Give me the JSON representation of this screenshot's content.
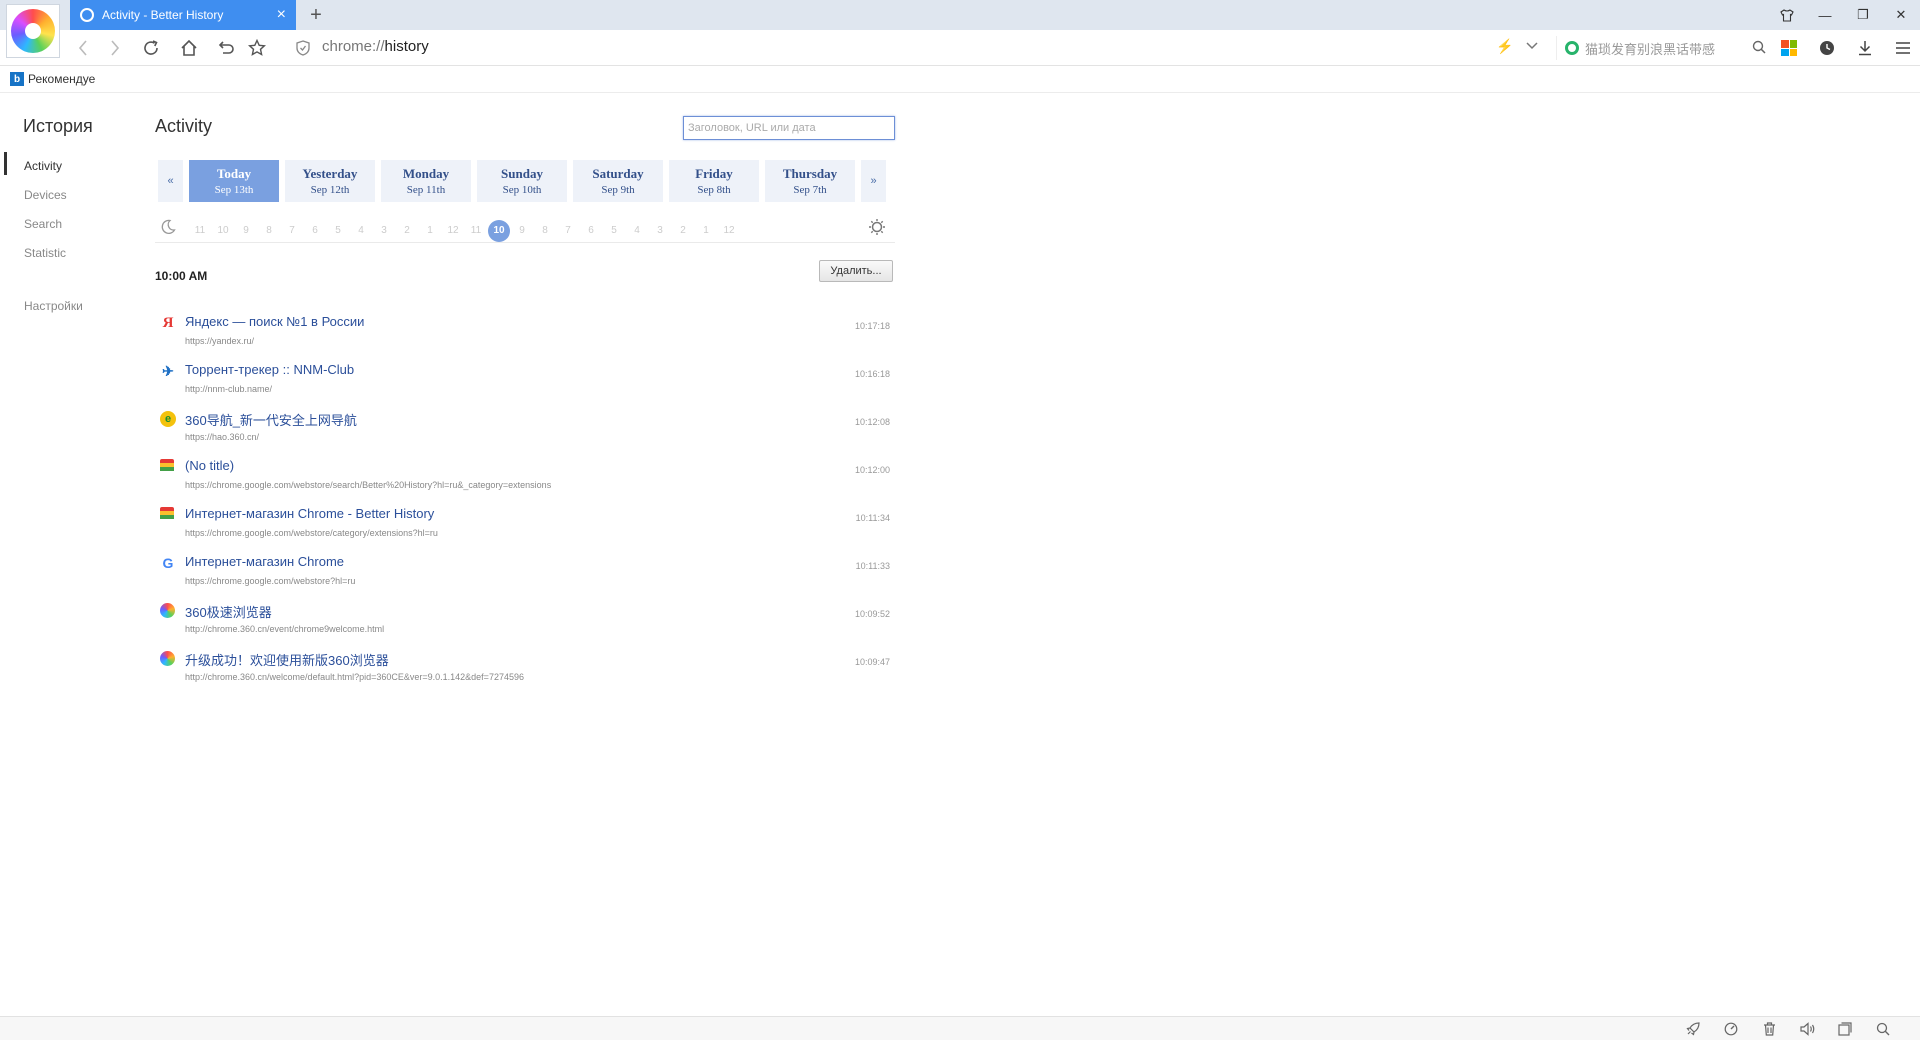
{
  "browser": {
    "tab_title": "Activity - Better History",
    "new_tab_symbol": "+",
    "address_scheme": "chrome://",
    "address_host": "history",
    "search_placeholder": "猫琐发育别浪黑话带感",
    "bookmark_label": "Рекомендуе",
    "bookmark_icon": "b"
  },
  "sidebar": {
    "title": "История",
    "items": [
      {
        "label": "Activity",
        "active": true
      },
      {
        "label": "Devices"
      },
      {
        "label": "Search"
      },
      {
        "label": "Statistic"
      }
    ],
    "settings_label": "Настройки"
  },
  "main": {
    "title": "Activity",
    "search_placeholder": "Заголовок, URL или дата",
    "prev_arrow": "«",
    "next_arrow": "»",
    "days": [
      {
        "name": "Today",
        "date": "Sep 13th",
        "selected": true
      },
      {
        "name": "Yesterday",
        "date": "Sep 12th"
      },
      {
        "name": "Monday",
        "date": "Sep 11th"
      },
      {
        "name": "Sunday",
        "date": "Sep 10th"
      },
      {
        "name": "Saturday",
        "date": "Sep 9th"
      },
      {
        "name": "Friday",
        "date": "Sep 8th"
      },
      {
        "name": "Thursday",
        "date": "Sep 7th"
      }
    ],
    "hours": [
      "11",
      "10",
      "9",
      "8",
      "7",
      "6",
      "5",
      "4",
      "3",
      "2",
      "1",
      "12",
      "11",
      "10",
      "9",
      "8",
      "7",
      "6",
      "5",
      "4",
      "3",
      "2",
      "1",
      "12"
    ],
    "active_hour_index": 13,
    "time_heading": "10:00 AM",
    "delete_label": "Удалить...",
    "visits": [
      {
        "icon": "yandex",
        "glyph": "Я",
        "title": "Яндекс — поиск №1 в России",
        "url": "https://yandex.ru/",
        "time": "10:17:18"
      },
      {
        "icon": "nnm",
        "glyph": "✈",
        "title": "Торрент-трекер :: NNM-Club",
        "url": "http://nnm-club.name/",
        "time": "10:16:18"
      },
      {
        "icon": "360nav",
        "glyph": "e",
        "title": "360导航_新一代安全上网导航",
        "url": "https://hao.360.cn/",
        "time": "10:12:08"
      },
      {
        "icon": "store",
        "glyph": "",
        "title": "(No title)",
        "url": "https://chrome.google.com/webstore/search/Better%20History?hl=ru&_category=extensions",
        "time": "10:12:00"
      },
      {
        "icon": "store",
        "glyph": "",
        "title": "Интернет-магазин Chrome - Better History",
        "url": "https://chrome.google.com/webstore/category/extensions?hl=ru",
        "time": "10:11:34"
      },
      {
        "icon": "google",
        "glyph": "G",
        "title": "Интернет-магазин Chrome",
        "url": "https://chrome.google.com/webstore?hl=ru",
        "time": "10:11:33"
      },
      {
        "icon": "360",
        "glyph": "",
        "title": "360极速浏览器",
        "url": "http://chrome.360.cn/event/chrome9welcome.html",
        "time": "10:09:52"
      },
      {
        "icon": "360",
        "glyph": "",
        "title": "升级成功！欢迎使用新版360浏览器",
        "url": "http://chrome.360.cn/welcome/default.html?pid=360CE&ver=9.0.1.142&def=7274596",
        "time": "10:09:47"
      }
    ]
  },
  "colors": {
    "tab_active": "#3f8ef0",
    "day_selected": "#7aa0e0",
    "link": "#2b4f9a"
  }
}
